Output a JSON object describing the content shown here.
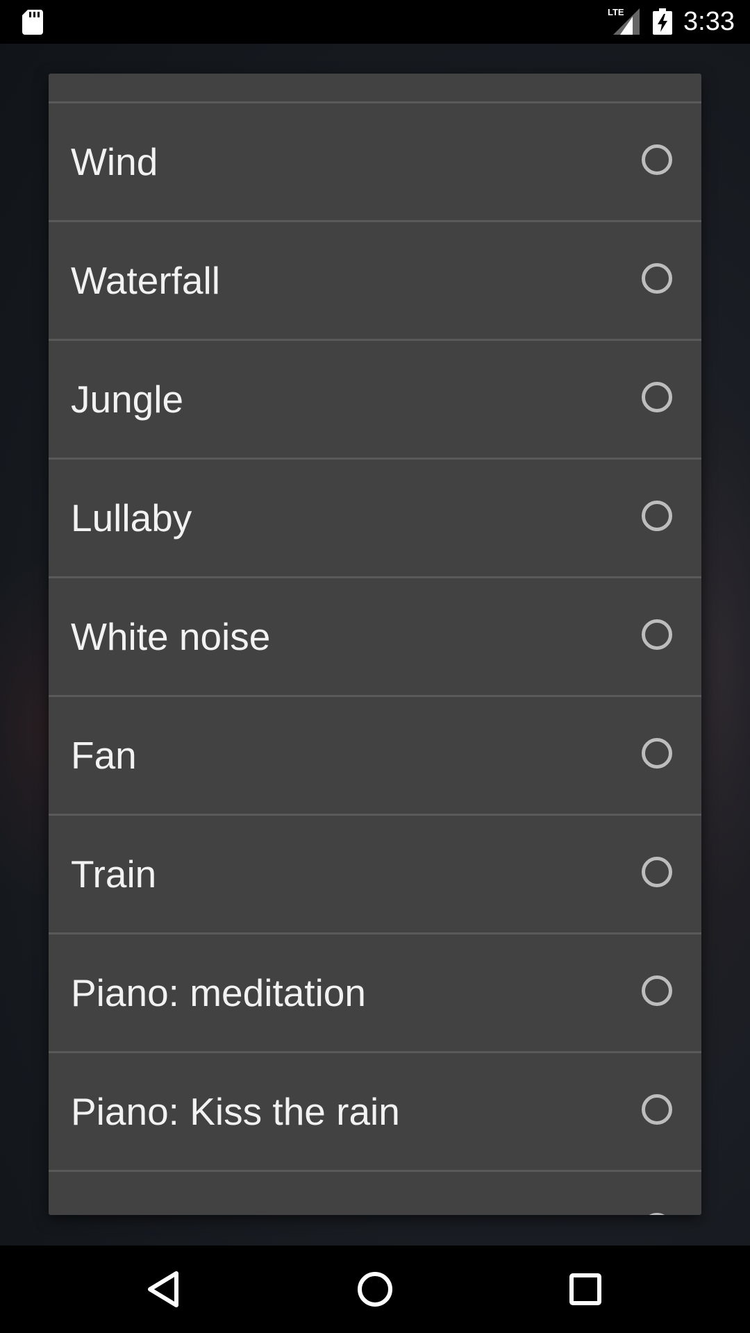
{
  "status_bar": {
    "time": "3:33",
    "network": "LTE",
    "icons": [
      "sd-card-icon",
      "lte-signal-icon",
      "battery-charging-icon"
    ]
  },
  "sound_list": {
    "items": [
      {
        "label": "Wind",
        "selected": false
      },
      {
        "label": "Waterfall",
        "selected": false
      },
      {
        "label": "Jungle",
        "selected": false
      },
      {
        "label": "Lullaby",
        "selected": false
      },
      {
        "label": "White noise",
        "selected": false
      },
      {
        "label": "Fan",
        "selected": false
      },
      {
        "label": "Train",
        "selected": false
      },
      {
        "label": "Piano: meditation",
        "selected": false
      },
      {
        "label": "Piano: Kiss the rain",
        "selected": false
      }
    ]
  },
  "nav_bar": {
    "buttons": [
      "back-icon",
      "home-icon",
      "recents-icon"
    ]
  },
  "colors": {
    "dialog_bg": "#424242",
    "divider": "#5a5a5a",
    "text": "#f2f2f2",
    "radio": "#bdbdbd"
  }
}
